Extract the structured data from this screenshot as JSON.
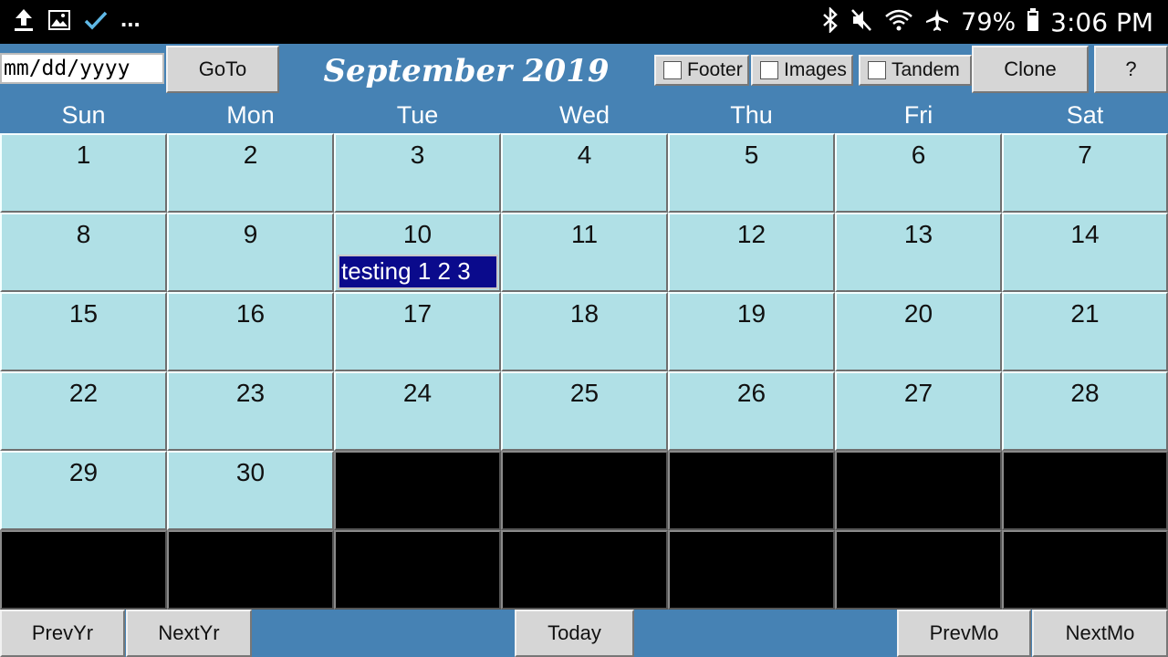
{
  "status_bar": {
    "icons_left": [
      "upload-icon",
      "image-icon",
      "check-icon"
    ],
    "overflow": "...",
    "icons_right": [
      "bluetooth-icon",
      "mute-icon",
      "wifi-icon",
      "airplane-icon",
      "battery-icon"
    ],
    "battery": "79%",
    "time": "3:06 PM"
  },
  "toolbar": {
    "date_placeholder": "mm/dd/yyyy",
    "goto_label": "GoTo",
    "month_title": "September 2019",
    "checkboxes": [
      {
        "label": "Footer",
        "checked": false
      },
      {
        "label": "Images",
        "checked": false
      },
      {
        "label": "Tandem",
        "checked": false
      }
    ],
    "clone_label": "Clone",
    "help_label": "?"
  },
  "weekdays": [
    "Sun",
    "Mon",
    "Tue",
    "Wed",
    "Thu",
    "Fri",
    "Sat"
  ],
  "calendar": {
    "weeks": [
      [
        "1",
        "2",
        "3",
        "4",
        "5",
        "6",
        "7"
      ],
      [
        "8",
        "9",
        "10",
        "11",
        "12",
        "13",
        "14"
      ],
      [
        "15",
        "16",
        "17",
        "18",
        "19",
        "20",
        "21"
      ],
      [
        "22",
        "23",
        "24",
        "25",
        "26",
        "27",
        "28"
      ],
      [
        "29",
        "30",
        "",
        "",
        "",
        "",
        ""
      ],
      [
        "",
        "",
        "",
        "",
        "",
        "",
        ""
      ]
    ],
    "events": [
      {
        "day": "10",
        "text": "testing 1 2 3"
      }
    ],
    "colors": {
      "day_cell": "#b0e0e6",
      "blank_cell": "#000000",
      "event_bg": "#0a0a8c",
      "header_bg": "#4682b4"
    }
  },
  "bottom_bar": {
    "prev_year": "PrevYr",
    "next_year": "NextYr",
    "today": "Today",
    "prev_month": "PrevMo",
    "next_month": "NextMo"
  }
}
